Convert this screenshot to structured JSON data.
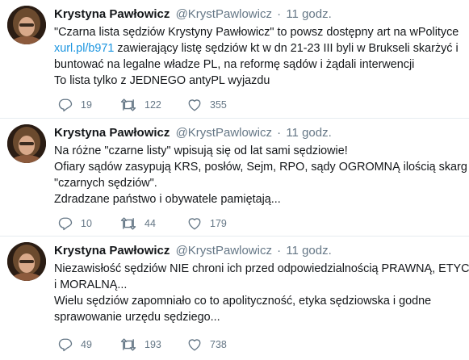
{
  "colors": {
    "link": "#1b95e0",
    "secondary": "#657786",
    "divider": "#e6ecf0"
  },
  "tweets": [
    {
      "name": "Krystyna Pawłowicz",
      "handle": "@KrystPawlowicz",
      "dot": "·",
      "time": "11 godz.",
      "lines": [
        "\"Czarna lista sędziów Krystyny Pawłowicz\" to powsz dostępny art na wPolityce",
        "zawierający listę sędziów kt w dn 21-23 III byli w Brukseli skarżyć i",
        "buntować na legalne władze PL, na reformę sądów i żądali interwencji",
        "To lista tylko z JEDNEGO antyPL wyjazdu"
      ],
      "link": "xurl.pl/b971",
      "reply_count": "19",
      "retweet_count": "122",
      "like_count": "355"
    },
    {
      "name": "Krystyna Pawłowicz",
      "handle": "@KrystPawlowicz",
      "dot": "·",
      "time": "11 godz.",
      "lines": [
        "Na różne \"czarne listy\" wpisują się od lat sami sędziowie!",
        "Ofiary sądów zasypują KRS, posłów, Sejm, RPO, sądy OGROMNĄ ilością skarg na",
        "\"czarnych sędziów\".",
        "Zdradzane państwo i obywatele pamiętają..."
      ],
      "reply_count": "10",
      "retweet_count": "44",
      "like_count": "179"
    },
    {
      "name": "Krystyna Pawłowicz",
      "handle": "@KrystPawlowicz",
      "dot": "·",
      "time": "11 godz.",
      "lines": [
        "Niezawisłość sędziów NIE chroni ich przed odpowiedzialnością PRAWNĄ, ETYCZNĄ",
        "i MORALNĄ...",
        "Wielu sędziów zapomniało co to apolityczność, etyka sędziowska i godne",
        "sprawowanie urzędu sędziego..."
      ],
      "reply_count": "49",
      "retweet_count": "193",
      "like_count": "738"
    }
  ],
  "icons": {
    "reply": "reply-icon",
    "retweet": "retweet-icon",
    "like": "heart-icon"
  }
}
